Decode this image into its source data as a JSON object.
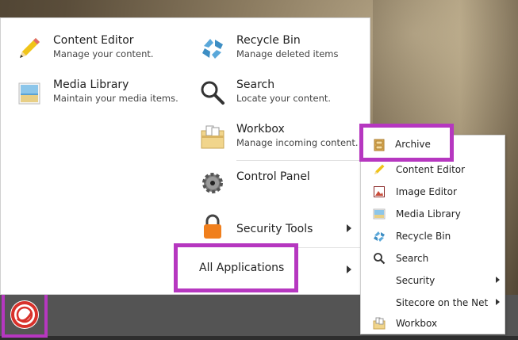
{
  "start_menu": {
    "left_items": [
      {
        "title": "Content Editor",
        "subtitle": "Manage your content."
      },
      {
        "title": "Media Library",
        "subtitle": "Maintain your media items."
      }
    ],
    "right_items": [
      {
        "title": "Recycle Bin",
        "subtitle": "Manage deleted items"
      },
      {
        "title": "Search",
        "subtitle": "Locate your content."
      },
      {
        "title": "Workbox",
        "subtitle": "Manage incoming content."
      },
      {
        "title": "Control Panel"
      },
      {
        "title": "Security Tools"
      }
    ],
    "all_applications": "All Applications"
  },
  "submenu": {
    "items": [
      {
        "label": "Archive",
        "icon": "archive-icon"
      },
      {
        "label": "Content Editor",
        "icon": "pencil-icon"
      },
      {
        "label": "Image Editor",
        "icon": "image-editor-icon"
      },
      {
        "label": "Media Library",
        "icon": "media-library-icon"
      },
      {
        "label": "Recycle Bin",
        "icon": "recycle-icon"
      },
      {
        "label": "Search",
        "icon": "magnifier-icon"
      },
      {
        "label": "Security",
        "icon": ""
      },
      {
        "label": "Sitecore on the Net",
        "icon": ""
      },
      {
        "label": "Workbox",
        "icon": "workbox-icon"
      }
    ]
  },
  "colors": {
    "highlight": "#b637c0",
    "taskbar": "#545454",
    "logo_red": "#d8312b"
  }
}
